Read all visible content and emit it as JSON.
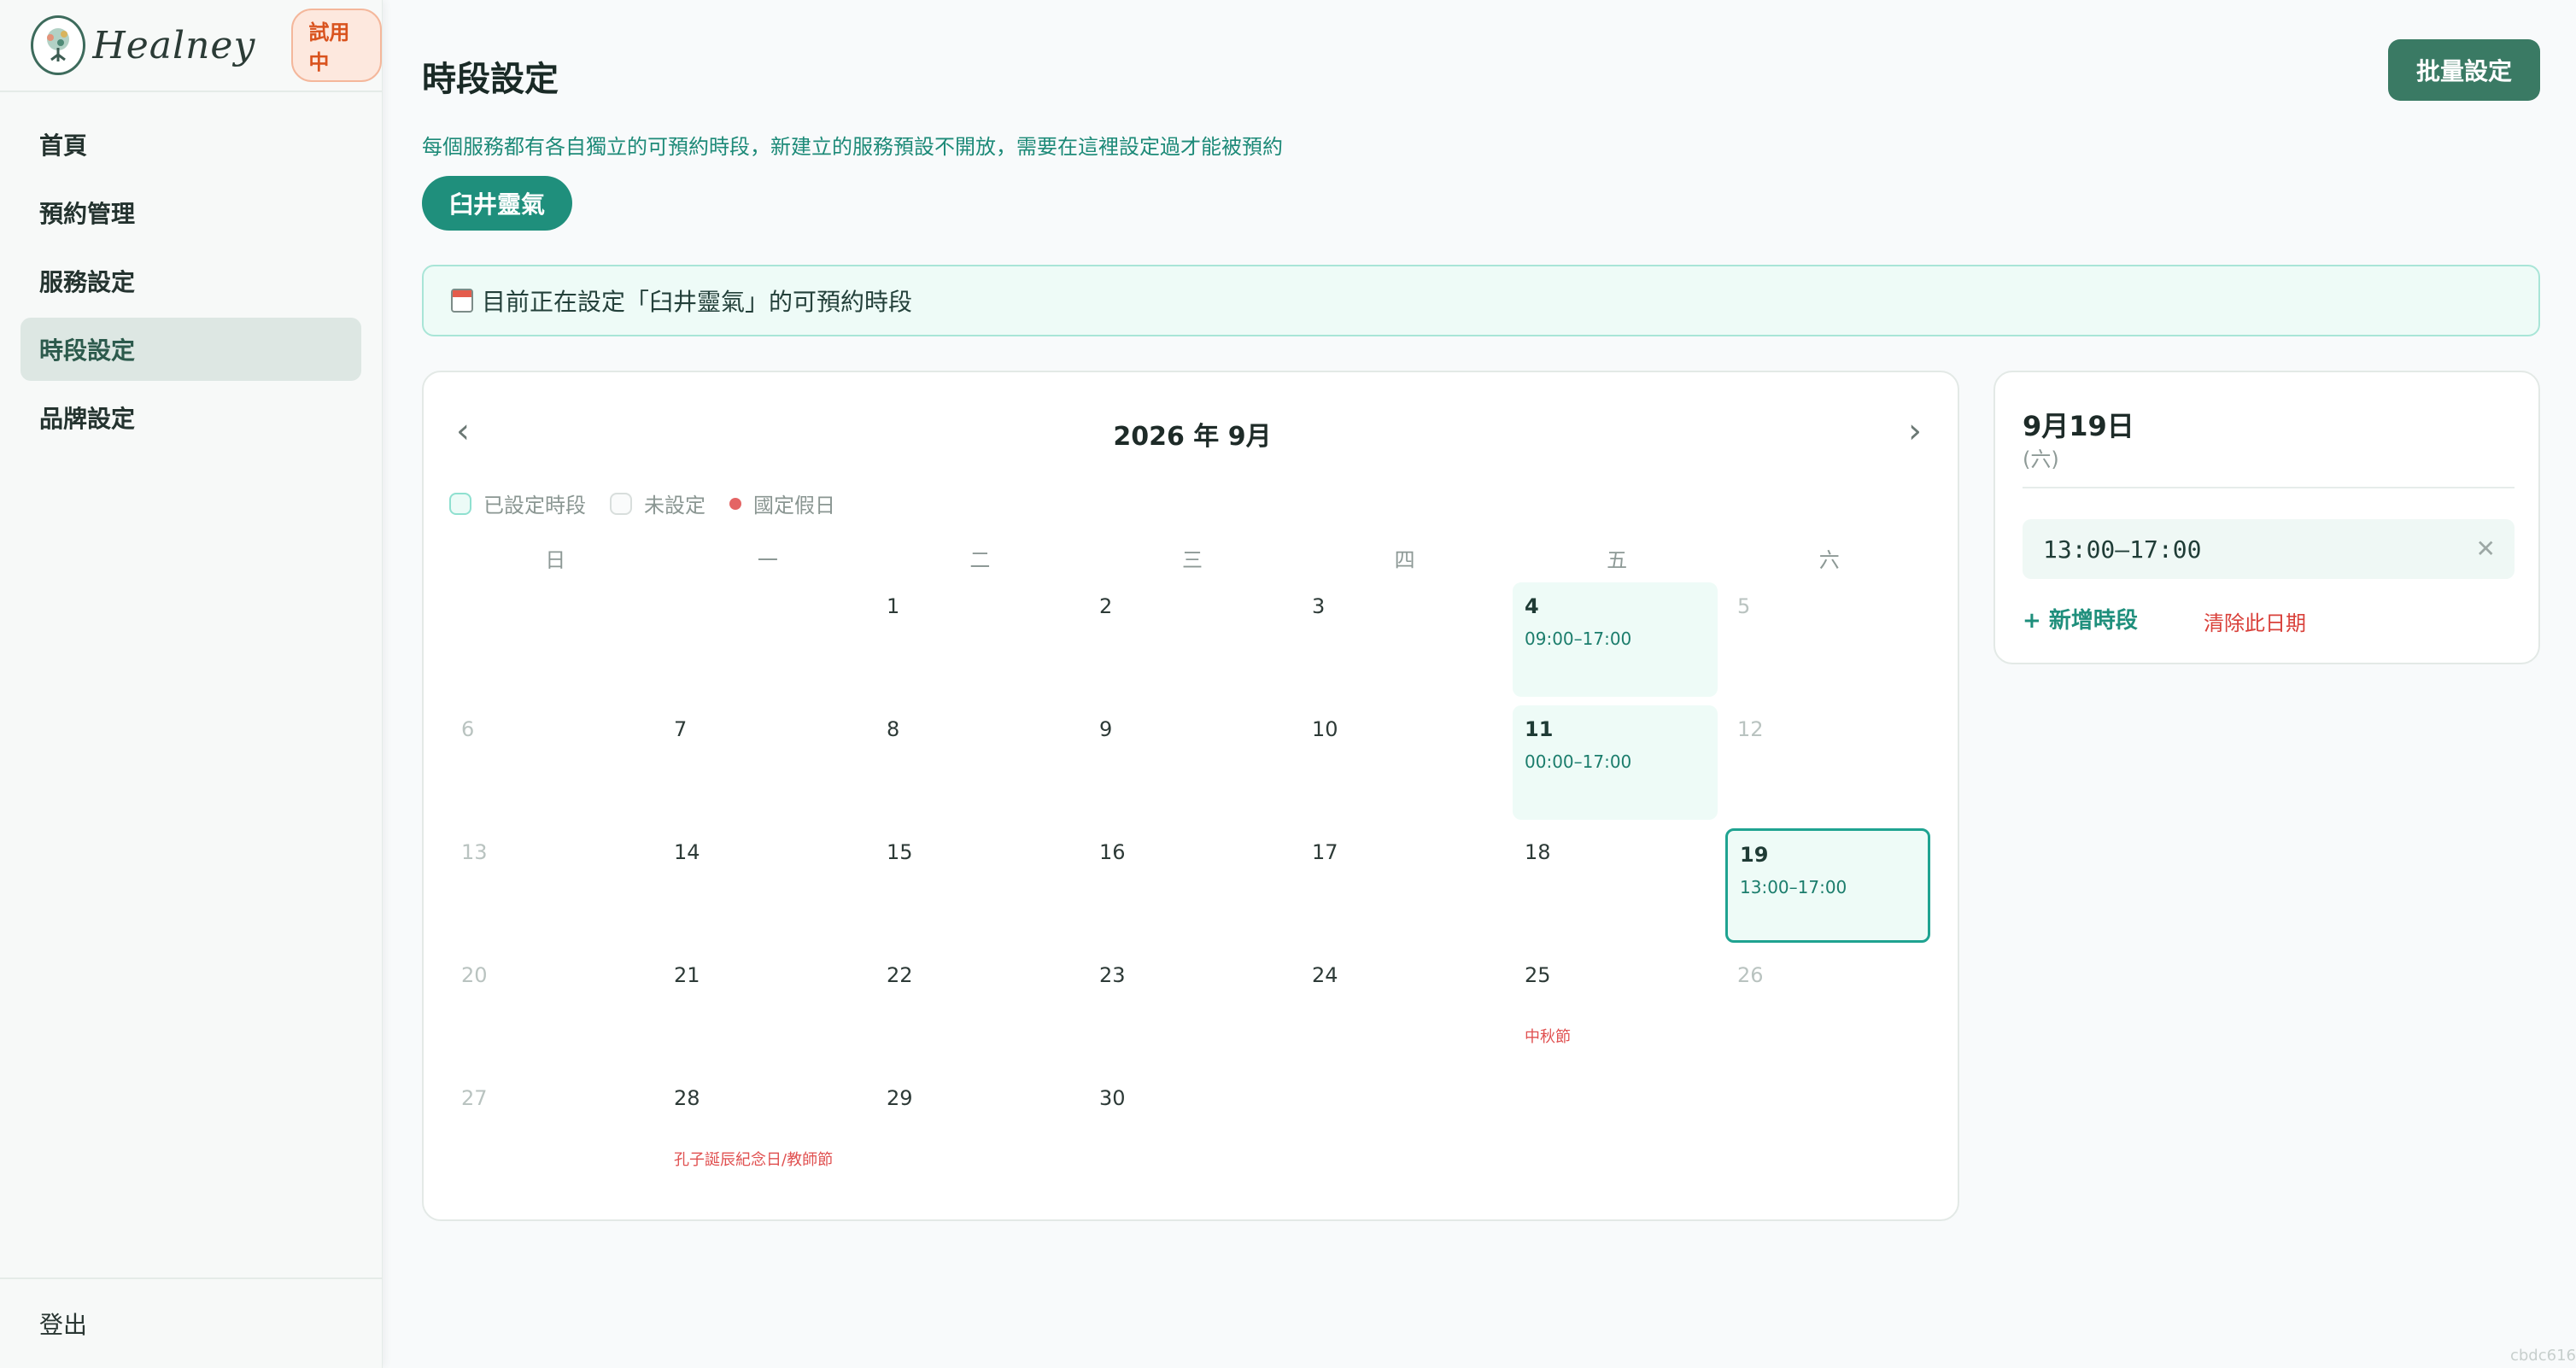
{
  "brand": {
    "name": "Healney",
    "trial_badge": "試用中"
  },
  "sidebar": {
    "items": [
      {
        "label": "首頁",
        "active": false
      },
      {
        "label": "預約管理",
        "active": false
      },
      {
        "label": "服務設定",
        "active": false
      },
      {
        "label": "時段設定",
        "active": true
      },
      {
        "label": "品牌設定",
        "active": false
      }
    ],
    "logout_label": "登出"
  },
  "header": {
    "title": "時段設定",
    "batch_button": "批量設定",
    "description": "每個服務都有各自獨立的可預約時段，新建立的服務預設不開放，需要在這裡設定過才能被預約"
  },
  "service": {
    "selected": "臼井靈氣"
  },
  "notice": {
    "text": "目前正在設定「臼井靈氣」的可預約時段"
  },
  "calendar": {
    "month_label": "2026 年 9月",
    "legend": {
      "set": "已設定時段",
      "unset": "未設定",
      "holiday": "國定假日"
    },
    "weekdays": [
      "日",
      "一",
      "二",
      "三",
      "四",
      "五",
      "六"
    ],
    "weeks": [
      [
        null,
        null,
        {
          "day": "1"
        },
        {
          "day": "2"
        },
        {
          "day": "3"
        },
        {
          "day": "4",
          "slot": "09:00–17:00"
        },
        {
          "day": "5"
        }
      ],
      [
        {
          "day": "6"
        },
        {
          "day": "7"
        },
        {
          "day": "8"
        },
        {
          "day": "9"
        },
        {
          "day": "10"
        },
        {
          "day": "11",
          "slot": "00:00–17:00"
        },
        {
          "day": "12"
        }
      ],
      [
        {
          "day": "13"
        },
        {
          "day": "14"
        },
        {
          "day": "15"
        },
        {
          "day": "16"
        },
        {
          "day": "17"
        },
        {
          "day": "18"
        },
        {
          "day": "19",
          "slot": "13:00–17:00",
          "selected": true
        }
      ],
      [
        {
          "day": "20"
        },
        {
          "day": "21"
        },
        {
          "day": "22"
        },
        {
          "day": "23"
        },
        {
          "day": "24"
        },
        {
          "day": "25",
          "holiday": "中秋節"
        },
        {
          "day": "26"
        }
      ],
      [
        {
          "day": "27"
        },
        {
          "day": "28",
          "holiday": "孔子誕辰紀念日/教師節"
        },
        {
          "day": "29"
        },
        {
          "day": "30"
        },
        null,
        null,
        null
      ]
    ]
  },
  "detail": {
    "date": "9月19日",
    "weekday": "(六)",
    "slots": [
      "13:00–17:00"
    ],
    "add_slot_label": "+ 新增時段",
    "clear_label": "清除此日期"
  },
  "build_id": "cbdc616",
  "colors": {
    "accent": "#1f8f7c",
    "holiday": "#e05050",
    "trial": "#d9531e"
  }
}
